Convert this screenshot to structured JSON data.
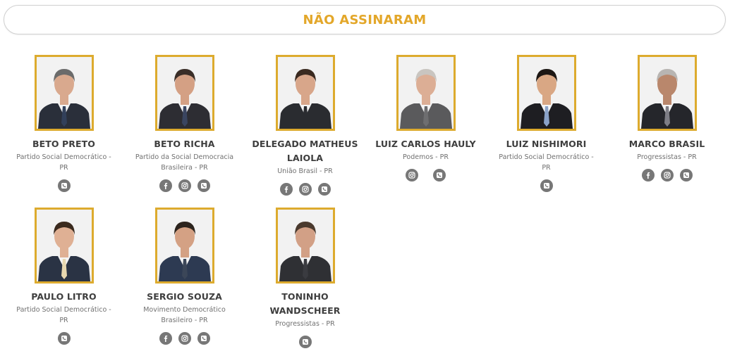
{
  "header": {
    "title": "NÃO ASSINARAM"
  },
  "people": [
    {
      "name": "BETO PRETO",
      "party": "Partido Social Democrático - PR",
      "icons": [
        "phone"
      ],
      "suit": "#2a2f3a",
      "tie": "#32405a",
      "hair": "#6b6b6b",
      "skin": "#d9a98e"
    },
    {
      "name": "BETO RICHA",
      "party": "Partido da Social Democracia Brasileira - PR",
      "icons": [
        "facebook",
        "instagram",
        "phone"
      ],
      "suit": "#2d2d33",
      "tie": "#3a4560",
      "hair": "#3a2e28",
      "skin": "#d4a084"
    },
    {
      "name": "DELEGADO MATHEUS LAIOLA",
      "party": "União Brasil - PR",
      "icons": [
        "facebook",
        "instagram",
        "phone"
      ],
      "suit": "#2a2c30",
      "tie": "#2a2c30",
      "hair": "#3a2a20",
      "skin": "#d8a68a"
    },
    {
      "name": "LUIZ CARLOS HAULY",
      "party": "Podemos - PR",
      "icons": [
        "instagram",
        "phone"
      ],
      "suit": "#5a5a5c",
      "tie": "#6e6e70",
      "hair": "#c9c5c0",
      "skin": "#dcae95"
    },
    {
      "name": "LUIZ NISHIMORI",
      "party": "Partido Social Democrático - PR",
      "icons": [
        "phone"
      ],
      "suit": "#1e1e22",
      "tie": "#8aa2c8",
      "hair": "#1c1714",
      "skin": "#d9a784"
    },
    {
      "name": "MARCO BRASIL",
      "party": "Progressistas - PR",
      "icons": [
        "facebook",
        "instagram",
        "phone"
      ],
      "suit": "#25262b",
      "tie": "#7e7e86",
      "hair": "#b8b5b2",
      "skin": "#b9876c"
    },
    {
      "name": "PAULO LITRO",
      "party": "Partido Social Democrático - PR",
      "icons": [
        "phone"
      ],
      "suit": "#2a3344",
      "tie": "#e8d8b0",
      "hair": "#3a2a1e",
      "skin": "#dfb094"
    },
    {
      "name": "SERGIO SOUZA",
      "party": "Movimento Democrático Brasileiro - PR",
      "icons": [
        "facebook",
        "instagram",
        "phone"
      ],
      "suit": "#2d3a52",
      "tie": "#3b4658",
      "hair": "#2c241e",
      "skin": "#d4a184"
    },
    {
      "name": "TONINHO WANDSCHEER",
      "party": "Progressistas - PR",
      "icons": [
        "phone"
      ],
      "suit": "#2f3034",
      "tie": "#3a3b40",
      "hair": "#4a3a2e",
      "skin": "#d2a086"
    }
  ]
}
